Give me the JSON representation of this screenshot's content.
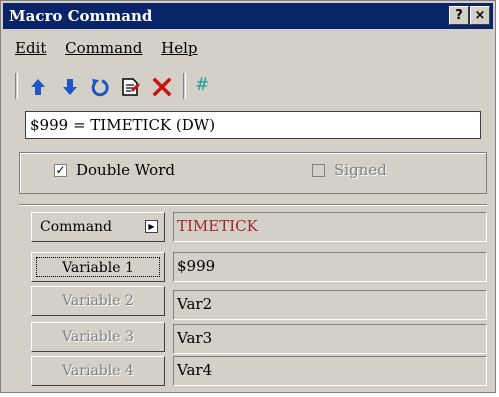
{
  "window": {
    "title": "Macro Command",
    "help_button": "?",
    "close_button": "×"
  },
  "menu": {
    "edit": "Edit",
    "command": "Command",
    "help": "Help"
  },
  "toolbar": {
    "icons": [
      "up-arrow-icon",
      "down-arrow-icon",
      "undo-icon",
      "edit-document-icon",
      "delete-icon",
      "hash-icon"
    ],
    "hash_label": "#",
    "colors": {
      "blue": "#1e56c8",
      "red": "#cc1111",
      "teal": "#1a9a9a"
    }
  },
  "expression": "$999 = TIMETICK (DW)",
  "options": {
    "double_word": {
      "label": "Double Word",
      "checked": true
    },
    "signed": {
      "label": "Signed",
      "checked": false,
      "enabled": false
    }
  },
  "command": {
    "label": "Command",
    "value": "TIMETICK"
  },
  "variables": [
    {
      "label": "Variable 1",
      "value": "$999",
      "enabled": true
    },
    {
      "label": "Variable 2",
      "value": "Var2",
      "enabled": false
    },
    {
      "label": "Variable 3",
      "value": "Var3",
      "enabled": false
    },
    {
      "label": "Variable 4",
      "value": "Var4",
      "enabled": false
    }
  ]
}
